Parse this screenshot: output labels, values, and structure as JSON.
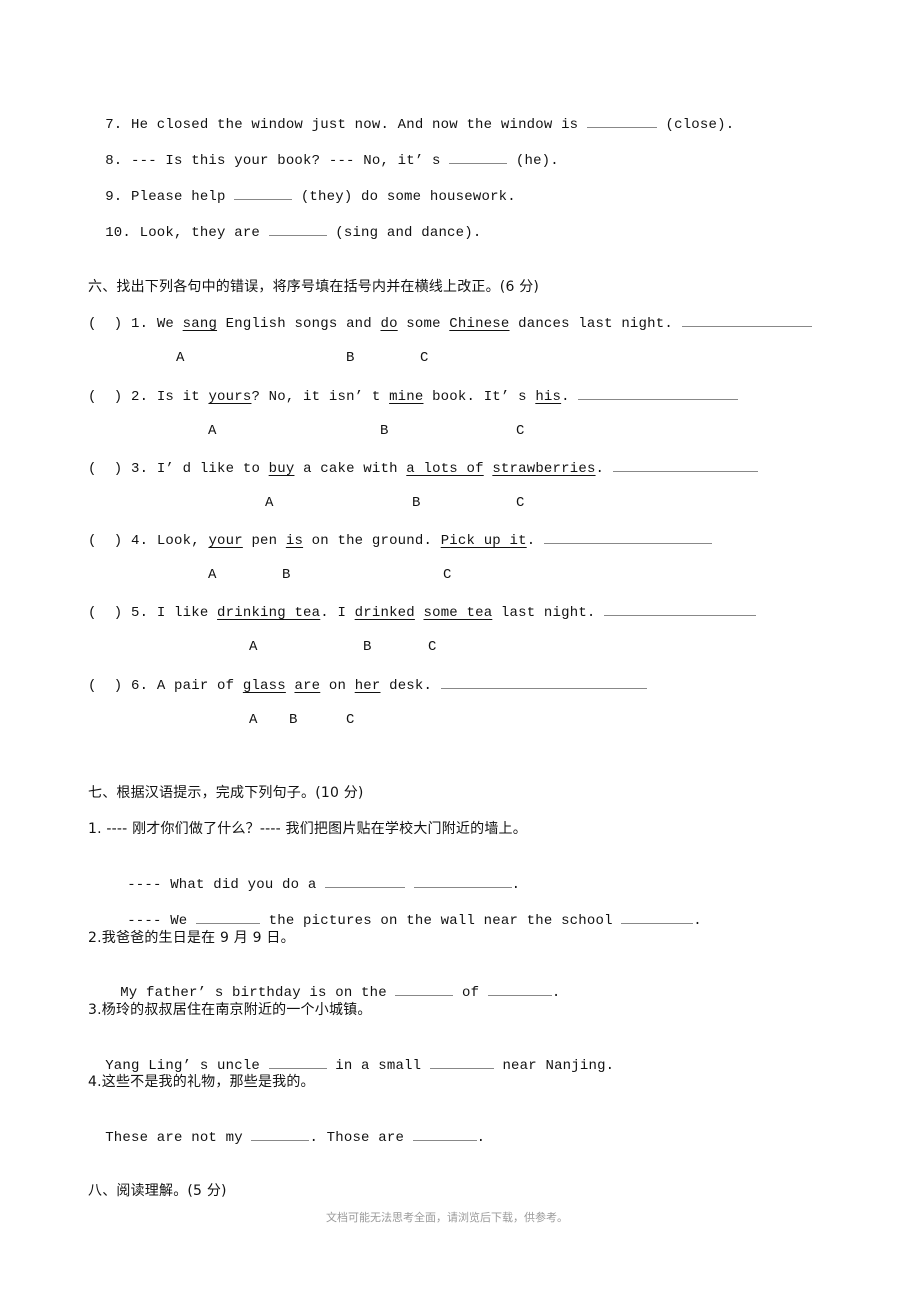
{
  "section5_items": [
    {
      "before": "7. He closed the window just now. And now the window is ",
      "after": " (close)."
    },
    {
      "before": "8. --- Is this your book? --- No, it’ s ",
      "after": " (he)."
    },
    {
      "before": "9. Please help ",
      "after": " (they) do some housework."
    },
    {
      "before": "10. Look, they are ",
      "after": " (sing and dance)."
    }
  ],
  "section6": {
    "heading": "六、找出下列各句中的错误，将序号填在括号内并在横线上改正。(6 分)",
    "paren": "(  )",
    "items": [
      {
        "num": "1.",
        "parts": [
          {
            "t": "We ",
            "u": false
          },
          {
            "t": "sang",
            "u": true
          },
          {
            "t": " English songs and ",
            "u": false
          },
          {
            "t": "do",
            "u": true
          },
          {
            "t": " some ",
            "u": false
          },
          {
            "t": "Chinese",
            "u": true
          },
          {
            "t": " dances last night. ",
            "u": false
          }
        ],
        "options": [
          "A",
          "B",
          "C"
        ]
      },
      {
        "num": "2.",
        "parts": [
          {
            "t": "Is it ",
            "u": false
          },
          {
            "t": "yours",
            "u": true
          },
          {
            "t": "? No, it isn’ t ",
            "u": false
          },
          {
            "t": "mine",
            "u": true
          },
          {
            "t": " book. It’ s ",
            "u": false
          },
          {
            "t": "his",
            "u": true
          },
          {
            "t": ". ",
            "u": false
          }
        ],
        "options": [
          "A",
          "B",
          "C"
        ]
      },
      {
        "num": "3.",
        "parts": [
          {
            "t": "I’ d like to ",
            "u": false
          },
          {
            "t": "buy",
            "u": true
          },
          {
            "t": " a cake with ",
            "u": false
          },
          {
            "t": "a lots of",
            "u": true
          },
          {
            "t": " ",
            "u": false
          },
          {
            "t": "strawberries",
            "u": true
          },
          {
            "t": ". ",
            "u": false
          }
        ],
        "options": [
          "A",
          "B",
          "C"
        ]
      },
      {
        "num": "4.",
        "parts": [
          {
            "t": "Look, ",
            "u": false
          },
          {
            "t": "your",
            "u": true
          },
          {
            "t": " pen ",
            "u": false
          },
          {
            "t": "is",
            "u": true
          },
          {
            "t": " on the ground. ",
            "u": false
          },
          {
            "t": "Pick up it",
            "u": true
          },
          {
            "t": ". ",
            "u": false
          }
        ],
        "options": [
          "A",
          "B",
          "C"
        ]
      },
      {
        "num": "5.",
        "parts": [
          {
            "t": "I like ",
            "u": false
          },
          {
            "t": "drinking tea",
            "u": true
          },
          {
            "t": ". I ",
            "u": false
          },
          {
            "t": "drinked",
            "u": true
          },
          {
            "t": " ",
            "u": false
          },
          {
            "t": "some tea",
            "u": true
          },
          {
            "t": " last night. ",
            "u": false
          }
        ],
        "options": [
          "A",
          "B",
          "C"
        ]
      },
      {
        "num": "6.",
        "parts": [
          {
            "t": "A pair of ",
            "u": false
          },
          {
            "t": "glass",
            "u": true
          },
          {
            "t": " ",
            "u": false
          },
          {
            "t": "are",
            "u": true
          },
          {
            "t": " on ",
            "u": false
          },
          {
            "t": "her",
            "u": true
          },
          {
            "t": " desk. ",
            "u": false
          }
        ],
        "options": [
          "A",
          "B",
          "C"
        ]
      }
    ]
  },
  "section7": {
    "heading": "七、根据汉语提示，完成下列句子。(10 分)",
    "q1_cn": "1. ---- 刚才你们做了什么？---- 我们把图片贴在学校大门附近的墙上。",
    "q1_en1_before": "---- What did you do a ",
    "q1_en1_after": ".",
    "q1_en2_before": "---- We ",
    "q1_en2_mid": " the pictures on the wall near the school ",
    "q1_en2_after": ".",
    "q2_cn": "2.我爸爸的生日是在 9 月 9 日。",
    "q2_en_before": "My father’ s birthday is on the ",
    "q2_en_mid": " of ",
    "q2_en_after": ".",
    "q3_cn": "3.杨玲的叔叔居住在南京附近的一个小城镇。",
    "q3_en_before": "Yang Ling’ s uncle ",
    "q3_en_mid": " in a small ",
    "q3_en_after": " near Nanjing.",
    "q4_cn": "4.这些不是我的礼物，那些是我的。",
    "q4_en_before": "These are not my ",
    "q4_en_mid": ". Those are ",
    "q4_en_after": "."
  },
  "section8": {
    "heading": "八、阅读理解。(5 分)"
  },
  "footer": "文档可能无法思考全面，请浏览后下载，供参考。"
}
